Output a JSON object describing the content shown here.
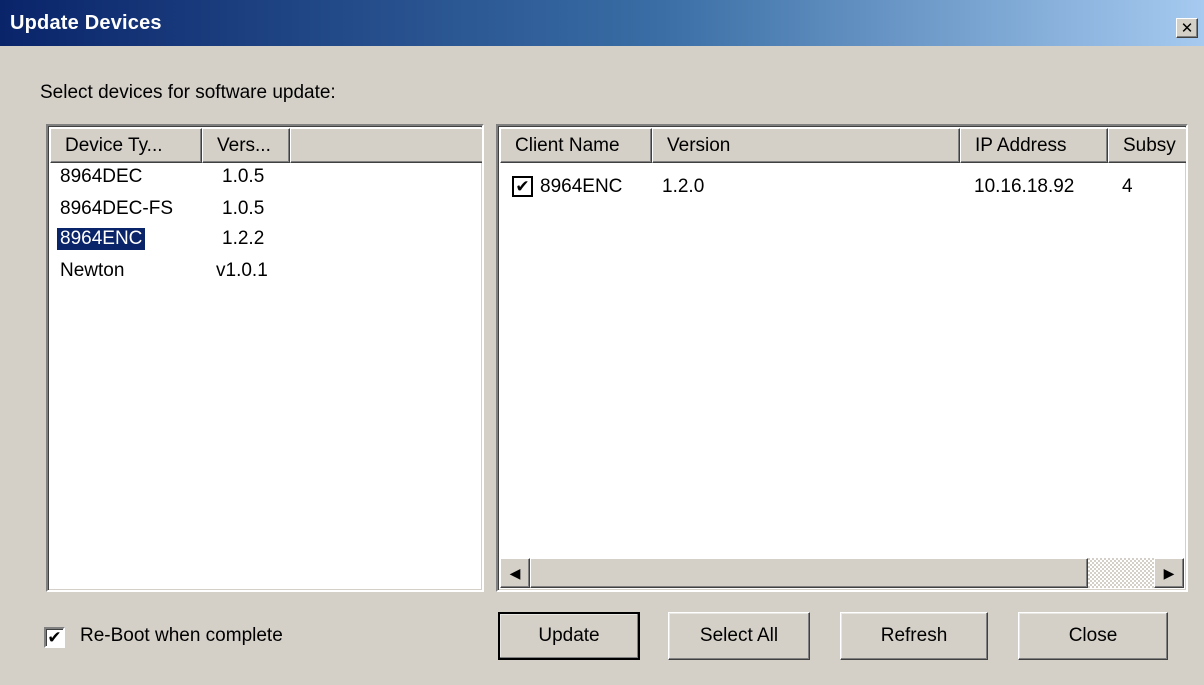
{
  "window": {
    "title": "Update Devices",
    "close_glyph": "✕",
    "close_icon": "close-icon"
  },
  "prompt": "Select devices for software update:",
  "device_types": {
    "headers": [
      "Device Ty...",
      "Vers..."
    ],
    "rows": [
      {
        "type": "8964DEC",
        "version": "1.0.5",
        "selected": false
      },
      {
        "type": "8964DEC-FS",
        "version": "1.0.5",
        "selected": false
      },
      {
        "type": "8964ENC",
        "version": "1.2.2",
        "selected": true
      },
      {
        "type": "Newton",
        "version": "v1.0.1",
        "selected": false
      }
    ]
  },
  "clients": {
    "headers": [
      "Client Name",
      "Version",
      "IP Address",
      "Subsy"
    ],
    "rows": [
      {
        "checked": true,
        "check_glyph": "✔",
        "name": "8964ENC",
        "version": "1.2.0",
        "ip": "10.16.18.92",
        "subsystem": "4"
      }
    ],
    "scroll_left_glyph": "◀",
    "scroll_right_glyph": "▶"
  },
  "reboot": {
    "label": "Re-Boot when complete",
    "checked": true,
    "check_glyph": "✔"
  },
  "buttons": {
    "update": "Update",
    "select_all": "Select All",
    "refresh": "Refresh",
    "close": "Close"
  },
  "colors": {
    "selection": "#0a246a",
    "face": "#d4d0c8",
    "title_start": "#0a246a",
    "title_end": "#a6caf0"
  }
}
